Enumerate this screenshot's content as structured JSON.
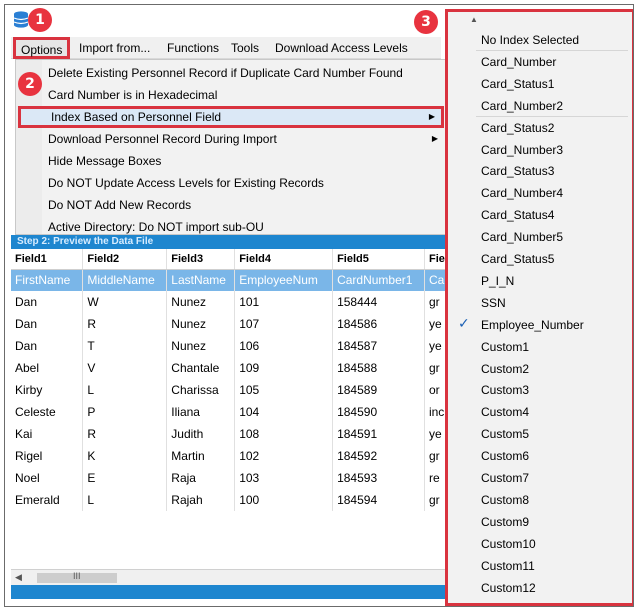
{
  "menubar": {
    "items": [
      "Options",
      "Import from...",
      "Functions",
      "Tools",
      "Download Access Levels"
    ]
  },
  "options_menu": {
    "items": [
      "Delete Existing Personnel Record if Duplicate Card Number Found",
      "Card Number is in Hexadecimal",
      "Index Based on Personnel Field",
      "Download Personnel Record During Import",
      "Hide Message Boxes",
      "Do NOT Update Access Levels for Existing Records",
      "Do NOT Add New Records",
      "Active Directory:  Do NOT import sub-OU"
    ]
  },
  "grid": {
    "step_header": "Step 2:  Preview the Data File",
    "columns": [
      "Field1",
      "Field2",
      "Field3",
      "Field4",
      "Field5",
      "Fie"
    ],
    "names_row": [
      "FirstName",
      "MiddleName",
      "LastName",
      "EmployeeNum",
      "CardNumber1",
      "Ca"
    ],
    "rows": [
      [
        "Dan",
        "W",
        "Nunez",
        "101",
        "158444",
        "gr"
      ],
      [
        "Dan",
        "R",
        "Nunez",
        "107",
        "184586",
        "ye"
      ],
      [
        "Dan",
        "T",
        "Nunez",
        "106",
        "184587",
        "ye"
      ],
      [
        "Abel",
        "V",
        "Chantale",
        "109",
        "184588",
        "gr"
      ],
      [
        "Kirby",
        "L",
        "Charissa",
        "105",
        "184589",
        "or"
      ],
      [
        "Celeste",
        "P",
        "Iliana",
        "104",
        "184590",
        "inc"
      ],
      [
        "Kai",
        "R",
        "Judith",
        "108",
        "184591",
        "ye"
      ],
      [
        "Rigel",
        "K",
        "Martin",
        "102",
        "184592",
        "gr"
      ],
      [
        "Noel",
        "E",
        "Raja",
        "103",
        "184593",
        "re"
      ],
      [
        "Emerald",
        "L",
        "Rajah",
        "100",
        "184594",
        "gr"
      ]
    ],
    "scroll_grip": "III"
  },
  "index_submenu": {
    "items": [
      "No Index Selected",
      "Card_Number",
      "Card_Status1",
      "Card_Number2",
      "Card_Status2",
      "Card_Number3",
      "Card_Status3",
      "Card_Number4",
      "Card_Status4",
      "Card_Number5",
      "Card_Status5",
      "P_I_N",
      "SSN",
      "Employee_Number",
      "Custom1",
      "Custom2",
      "Custom3",
      "Custom4",
      "Custom5",
      "Custom6",
      "Custom7",
      "Custom8",
      "Custom9",
      "Custom10",
      "Custom11",
      "Custom12"
    ],
    "checked": "Employee_Number"
  },
  "callouts": [
    "1",
    "2",
    "3"
  ],
  "colors": {
    "accent_red": "#d9333f",
    "header_blue": "#1e86cf",
    "names_row_blue": "#7ab6e8"
  },
  "icons": {
    "app": "database-icon",
    "check": "check-icon",
    "submenu_arrow": "chevron-right-icon",
    "scroll_up": "chevron-up-icon",
    "scroll_left": "chevron-left-icon"
  }
}
